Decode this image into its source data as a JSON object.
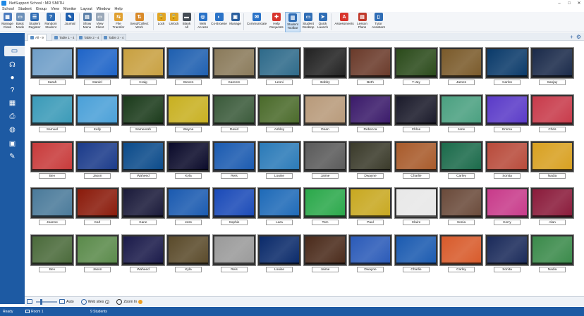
{
  "window": {
    "title": "NetSupport School : MR SMITH"
  },
  "menu": [
    "School",
    "Student",
    "Group",
    "View",
    "Monitor",
    "Layout",
    "Window",
    "Help"
  ],
  "ribbon": [
    {
      "label": "Manage\nClass",
      "icon": "manage-class-icon",
      "color": "#4a7bbf",
      "glyph": "▦"
    },
    {
      "label": "Basic\nMode",
      "icon": "basic-mode-icon",
      "color": "#6b8fb8",
      "glyph": "▭"
    },
    {
      "label": "Student\nRegister",
      "icon": "student-register-icon",
      "color": "#2f6db5",
      "glyph": "☰"
    },
    {
      "label": "Random\nStudent",
      "icon": "random-student-icon",
      "color": "#2f6db5",
      "glyph": "?"
    },
    {
      "sep": true
    },
    {
      "label": "Journal",
      "icon": "journal-icon",
      "color": "#1f5fae",
      "glyph": "✎"
    },
    {
      "sep": true
    },
    {
      "label": "Show\nMenu",
      "icon": "show-menu-icon",
      "color": "#5a7fa8",
      "glyph": "▤"
    },
    {
      "label": "View\nClient",
      "icon": "view-client-icon",
      "color": "#9aa8b8",
      "glyph": "▭"
    },
    {
      "sep": true
    },
    {
      "label": "File\nTransfer",
      "icon": "file-transfer-icon",
      "color": "#e0a030",
      "glyph": "⇆"
    },
    {
      "label": "Send/Collect\nWork",
      "icon": "send-collect-icon",
      "color": "#d98a2a",
      "glyph": "⇅"
    },
    {
      "sep": true
    },
    {
      "label": "Lock",
      "icon": "lock-icon",
      "color": "#e2a524",
      "glyph": "🔒"
    },
    {
      "label": "Unlock",
      "icon": "unlock-icon",
      "color": "#e2a524",
      "glyph": "🔓"
    },
    {
      "label": "Blank\nAll",
      "icon": "blank-all-icon",
      "color": "#444c55",
      "glyph": "▬"
    },
    {
      "sep": true
    },
    {
      "label": "Web\nAccess",
      "icon": "web-access-icon",
      "color": "#2a73c8",
      "glyph": "◎"
    },
    {
      "label": "Co-Browse",
      "icon": "co-browse-icon",
      "color": "#2a73c8",
      "glyph": "◐"
    },
    {
      "label": "Manage",
      "icon": "manage-icon",
      "color": "#2a5f9e",
      "glyph": "▣"
    },
    {
      "sep": true
    },
    {
      "label": "Communicate",
      "icon": "communicate-icon",
      "color": "#2a73c8",
      "glyph": "✉"
    },
    {
      "label": "Help\nRequests",
      "icon": "help-requests-icon",
      "color": "#d8342c",
      "glyph": "✚"
    },
    {
      "label": "Student\nToolbar",
      "icon": "student-toolbar-icon",
      "color": "#2f6db5",
      "glyph": "▥",
      "active": true
    },
    {
      "label": "Student\nDesktop",
      "icon": "student-desktop-icon",
      "color": "#2f6db5",
      "glyph": "▭"
    },
    {
      "label": "Quick\nLaunch",
      "icon": "quick-launch-icon",
      "color": "#2f6db5",
      "glyph": "➤"
    },
    {
      "sep": true
    },
    {
      "label": "Assessments",
      "icon": "assessments-icon",
      "color": "#d8342c",
      "glyph": "A"
    },
    {
      "label": "Lesson\nPlans",
      "icon": "lesson-plans-icon",
      "color": "#c0392b",
      "glyph": "▤"
    },
    {
      "label": "Tutor\nAssistant",
      "icon": "tutor-assistant-icon",
      "color": "#2f6db5",
      "glyph": "▯"
    }
  ],
  "tabs": [
    {
      "label": "All - 9",
      "active": true
    },
    {
      "label": "Table 1 - 4",
      "active": false
    },
    {
      "label": "Table 2 - 4",
      "active": false
    },
    {
      "label": "Table 3 - 4",
      "active": false
    }
  ],
  "sidebar": [
    {
      "icon": "monitor-icon",
      "glyph": "▭",
      "active": true
    },
    {
      "icon": "headphones-icon",
      "glyph": "☊"
    },
    {
      "icon": "chat-icon",
      "glyph": "●"
    },
    {
      "icon": "survey-icon",
      "glyph": "?"
    },
    {
      "icon": "grid-icon",
      "glyph": "▦"
    },
    {
      "icon": "printer-icon",
      "glyph": "⎙"
    },
    {
      "icon": "globe-icon",
      "glyph": "◍"
    },
    {
      "icon": "devices-icon",
      "glyph": "▣"
    },
    {
      "icon": "whiteboard-icon",
      "glyph": "✎"
    }
  ],
  "students": [
    [
      "Sarah",
      "Daniel",
      "Craig",
      "Steven",
      "Kareem",
      "Leoni",
      "Bobby",
      "Beth",
      "T-Jay",
      "James",
      "Carlos",
      "Sanjay"
    ],
    [
      "Samuel",
      "Kelly",
      "Sameerah",
      "Wayne",
      "David",
      "Ashley",
      "Dean",
      "Rebecca",
      "Chloe",
      "Jane",
      "Emma",
      "Chris"
    ],
    [
      "Bev",
      "Jason",
      "Waheed",
      "Kyla",
      "Reis",
      "Louise",
      "Jaime",
      "Dwayne",
      "Charlie",
      "Carley",
      "Sonita",
      "Nadia"
    ],
    [
      "Joanne",
      "Karl",
      "Kane",
      "Jess",
      "Sophie",
      "Lara",
      "Tom",
      "Paul",
      "Claire",
      "Sonia",
      "Kerry",
      "Alan"
    ],
    [
      "Bev",
      "Jason",
      "Waheed",
      "Kyla",
      "Reis",
      "Louise",
      "Jaime",
      "Dwayne",
      "Charlie",
      "Carley",
      "Sonita",
      "Nadia"
    ]
  ],
  "screens": [
    [
      "#6f9ec8",
      "#1e64c8",
      "#c8a040",
      "#1e5fb0",
      "#8a7a5a",
      "#2e6a8a",
      "#222",
      "#6a3a2a",
      "#2a4a1a",
      "#7a5a2a",
      "#0a3a6a",
      "#1a2a4a"
    ],
    [
      "#3a9ab8",
      "#4aa0d8",
      "#1a3a1a",
      "#c8b020",
      "#3a5a3a",
      "#4a6a2a",
      "#b89a7a",
      "#3a1a6a",
      "#1a1a2a",
      "#4aa080",
      "#5a3ac8",
      "#c83a4a"
    ],
    [
      "#c83a3a",
      "#1a3a8a",
      "#0a4a8a",
      "#0a0a2a",
      "#1a5ab0",
      "#2a7ab8",
      "#5a5a5a",
      "#3a3a2a",
      "#a85a2a",
      "#1a6a4a",
      "#b84a3a",
      "#d8a020"
    ],
    [
      "#4a7a9a",
      "#8a1a0a",
      "#1a1a3a",
      "#1a5ab0",
      "#1a4ab8",
      "#1e6ab8",
      "#2aa84a",
      "#c8a820",
      "#e8e8e8",
      "#6a4a3a",
      "#c83a8a",
      "#8a1a3a"
    ],
    [
      "#4a6a3a",
      "#5a8a4a",
      "#1a1a4a",
      "#5a4a2a",
      "#9a9a9a",
      "#0a2a6a",
      "#4a2a1a",
      "#2a5ab8",
      "#1a5ab0",
      "#d85a2a",
      "#1a2a5a",
      "#3a8a4a"
    ]
  ],
  "bottombar": {
    "auto_label": "Auto",
    "websites_label": "Web sites",
    "zoom_label": "Zoom In"
  },
  "status": {
    "ready": "Ready",
    "room": "Room 1",
    "students": "9 Students"
  },
  "colors": {
    "sidebar": "#1d5aa3",
    "statusbar": "#1d5aa3",
    "accent": "#3567a5"
  }
}
